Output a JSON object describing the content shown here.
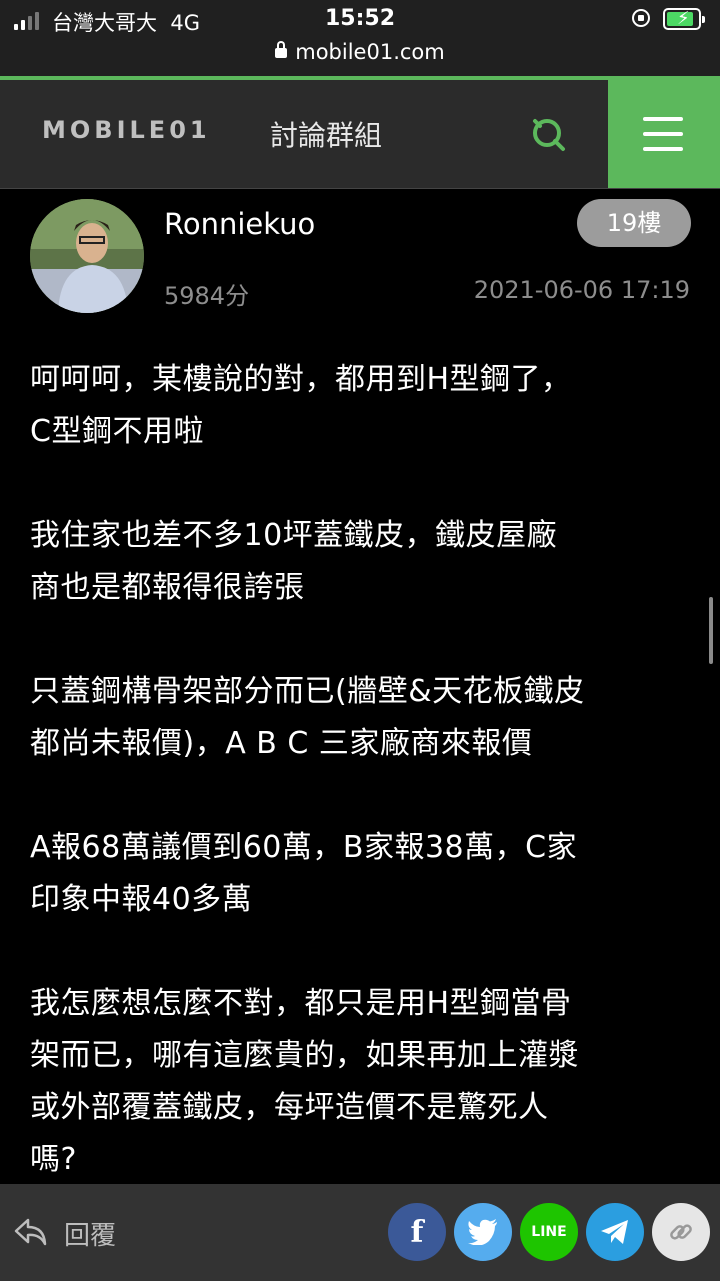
{
  "status_bar": {
    "carrier": "台灣大哥大",
    "network": "4G",
    "time": "15:52"
  },
  "browser": {
    "url": "mobile01.com"
  },
  "header": {
    "logo": "MOBILE01",
    "title": "討論群組"
  },
  "post": {
    "username": "Ronniekuo",
    "score": "5984分",
    "floor": "19樓",
    "date": "2021-06-06 17:19",
    "paragraphs": [
      [
        "呵呵呵，某樓說的對，都用到H型鋼了，",
        "C型鋼不用啦"
      ],
      [
        "我住家也差不多10坪蓋鐵皮，鐵皮屋廠",
        "商也是都報得很誇張"
      ],
      [
        "只蓋鋼構骨架部分而已(牆壁&天花板鐵皮",
        "都尚未報價)，A B C 三家廠商來報價"
      ],
      [
        "A報68萬議價到60萬，B家報38萬，C家",
        "印象中報40多萬"
      ],
      [
        "我怎麼想怎麼不對，都只是用H型鋼當骨",
        "架而已，哪有這麼貴的，如果再加上灌漿",
        "或外部覆蓋鐵皮，每坪造價不是驚死人",
        "嗎?"
      ]
    ]
  },
  "bottom_bar": {
    "reply_label": "回覆",
    "share_facebook": "f",
    "share_line": "LINE"
  },
  "colors": {
    "accent_green": "#5cb85c",
    "facebook": "#3b5998",
    "twitter": "#55acee",
    "line": "#1ec500",
    "telegram": "#2b9ee0"
  }
}
